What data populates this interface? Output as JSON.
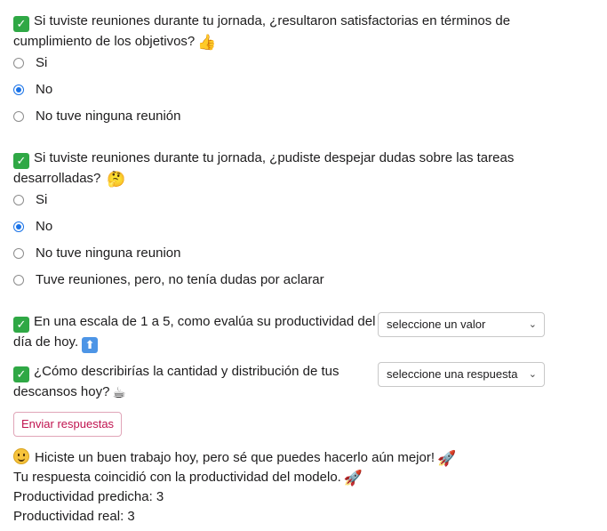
{
  "q1": {
    "line1": "Si tuviste reuniones durante tu jornada, ¿resultaron satisfactorias en términos de",
    "line2": "cumplimiento de los objetivos?",
    "emoji": "👍",
    "options": [
      "Si",
      "No",
      "No tuve ninguna reunión"
    ],
    "selected": "No"
  },
  "q2": {
    "line1": "Si tuviste reuniones durante tu jornada, ¿pudiste despejar dudas sobre las tareas",
    "line2": "desarrolladas?",
    "emoji": "🤔",
    "options": [
      "Si",
      "No",
      "No tuve ninguna reunion",
      "Tuve reuniones, pero, no tenía dudas por aclarar"
    ],
    "selected": "No"
  },
  "q3": {
    "line1": "En una escala de 1 a 5, como evalúa su productividad del",
    "line2": "día de hoy.",
    "emoji": "⬆",
    "select_value": "seleccione un valor"
  },
  "q4": {
    "line1": "¿Cómo describirías la cantidad y distribución de tus",
    "line2": "descansos hoy?",
    "emoji": "☕",
    "select_value": "seleccione una respuesta"
  },
  "submit_label": "Enviar respuestas",
  "result": {
    "message": "Hiciste un buen trabajo hoy, pero sé que puedes hacerlo aún mejor!",
    "coincidence": "Tu respuesta coincidió con la productividad del modelo.",
    "predicted": "Productividad predicha: 3",
    "real": "Productividad real: 3",
    "rocket": "🚀"
  },
  "icons": {
    "check": "check-mark-button-icon",
    "radio": "radio-icon",
    "chevron": "chevron-down-icon",
    "smile": "slightly-smiling-face-icon"
  },
  "colors": {
    "check_green": "#2fa845",
    "radio_selected": "#1a73e8",
    "button_text": "#c0134f",
    "button_border": "#e0a5b8"
  }
}
